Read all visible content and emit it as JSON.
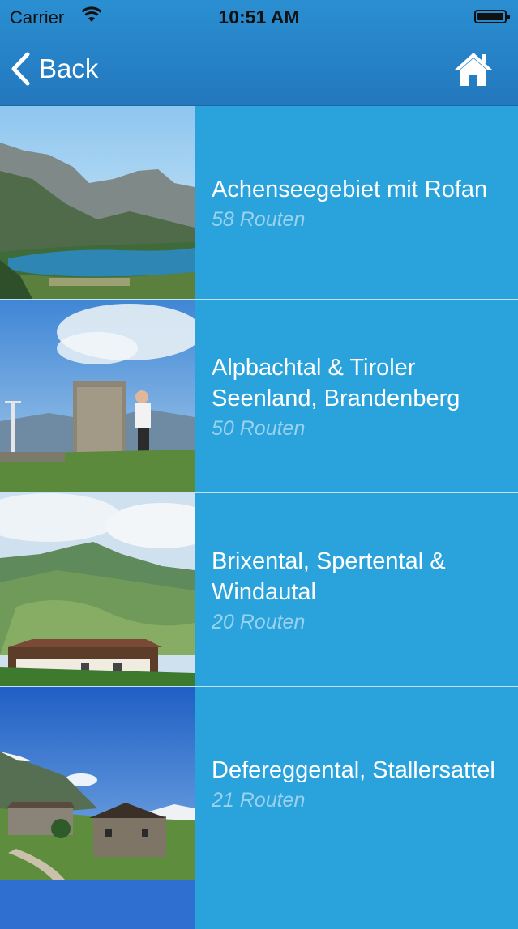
{
  "status_bar": {
    "carrier": "Carrier",
    "time": "10:51 AM"
  },
  "nav": {
    "back_label": "Back"
  },
  "regions": [
    {
      "title": "Achenseegebiet mit Rofan",
      "count": "58 Routen"
    },
    {
      "title": "Alpbachtal & Tiroler Seenland, Brandenberg",
      "count": "50 Routen"
    },
    {
      "title": "Brixental, Spertental & Windautal",
      "count": "20 Routen"
    },
    {
      "title": "Defereggental, Stallersattel",
      "count": "21 Routen"
    }
  ],
  "colors": {
    "header": "#2581c6",
    "list_bg": "#2aa3dc",
    "title_text": "#ffffff",
    "count_text": "#9ad2ee"
  }
}
